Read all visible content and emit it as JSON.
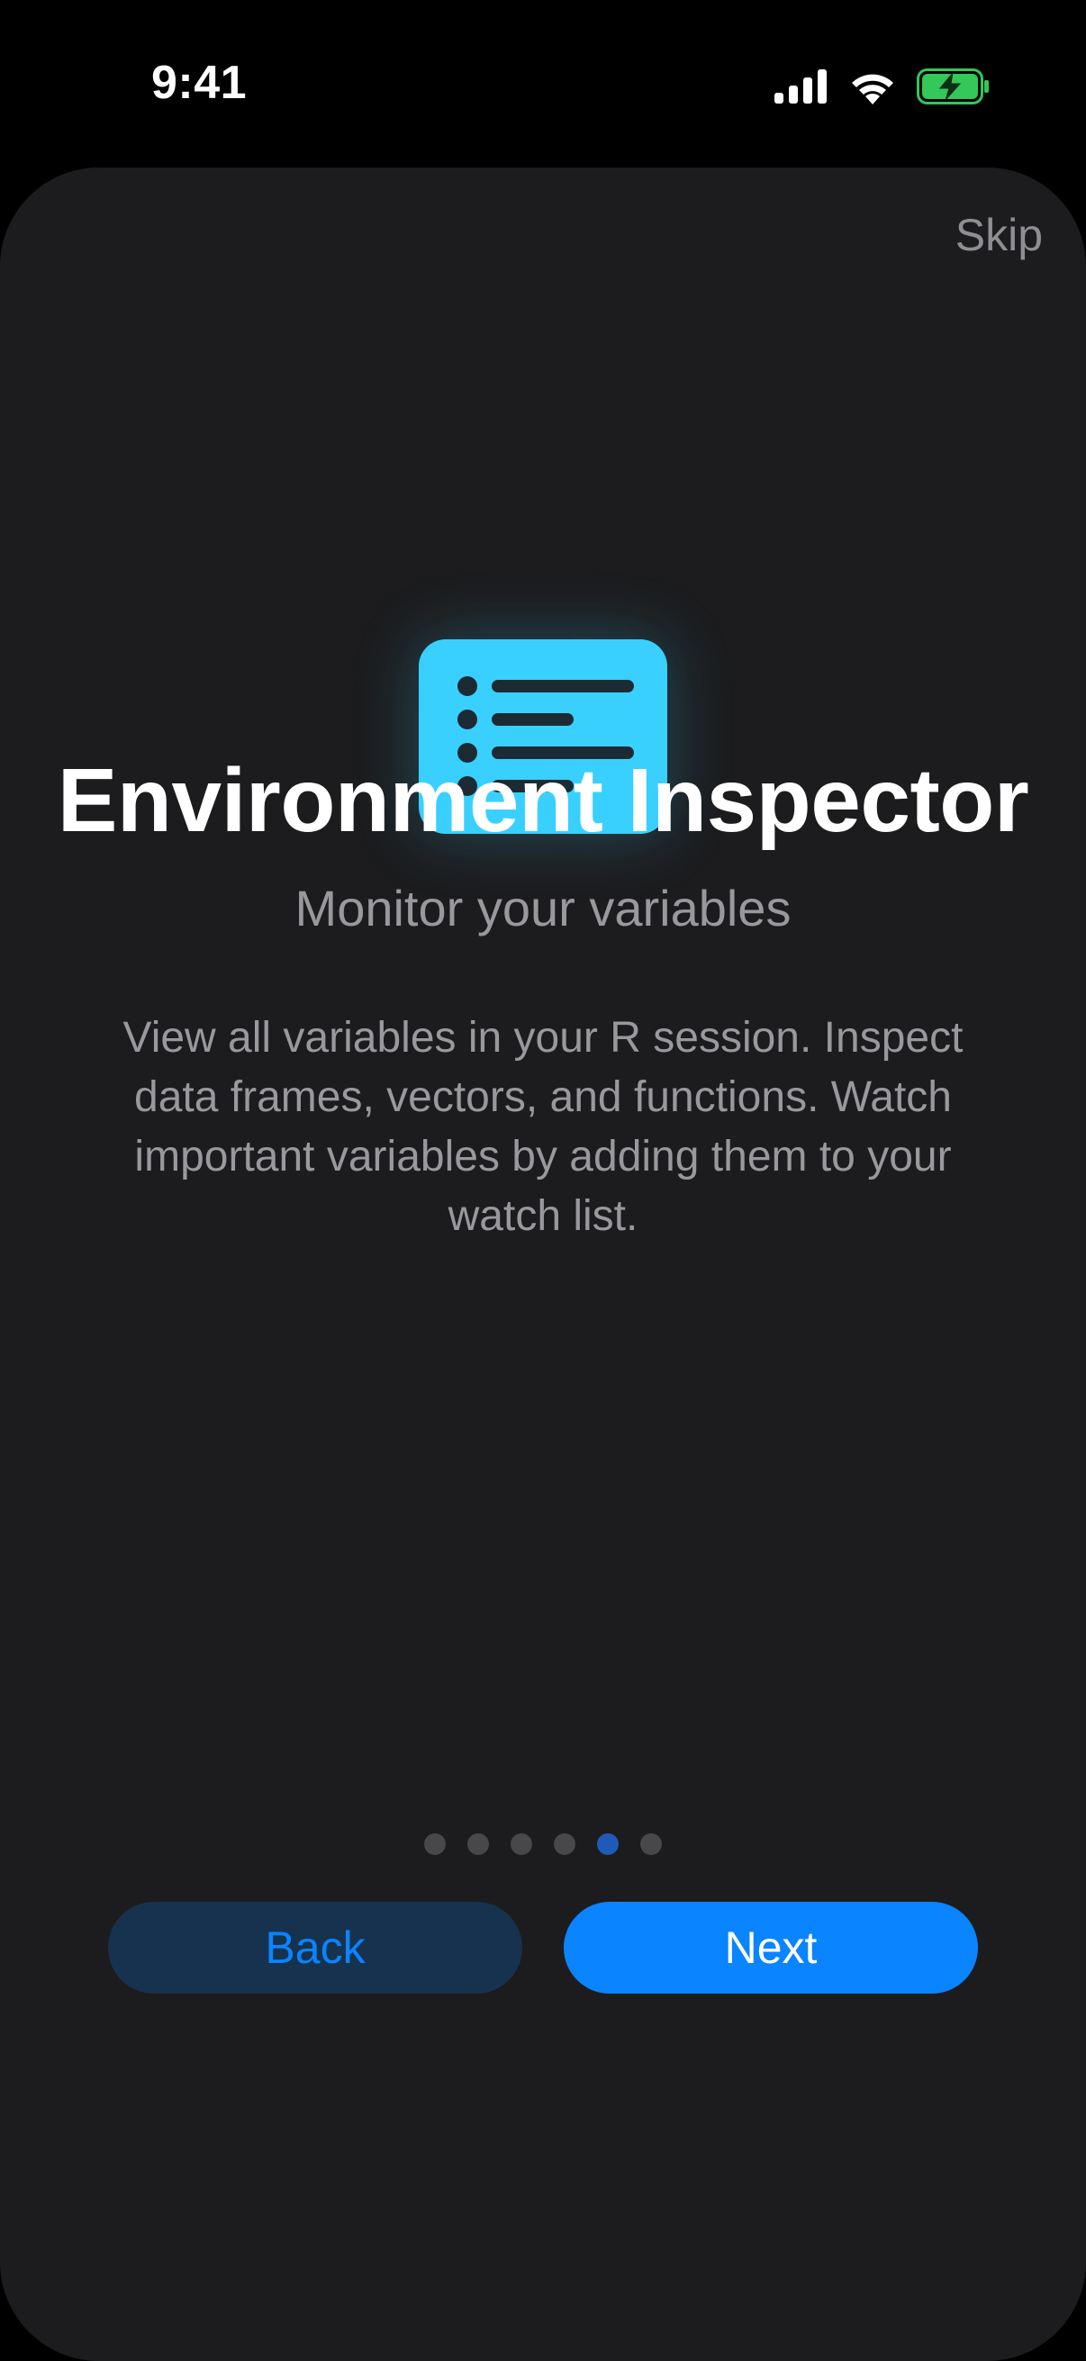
{
  "status_bar": {
    "time": "9:41",
    "icons": [
      "cellular-signal-icon",
      "wifi-icon",
      "battery-charging-icon"
    ],
    "battery_color": "#34c759"
  },
  "onboarding": {
    "skip_label": "Skip",
    "icon": "list-icon",
    "icon_color": "#39d0ff",
    "title": "Environment Inspector",
    "subtitle": "Monitor your variables",
    "description": "View all variables in your R session. Inspect data frames, vectors, and functions. Watch important variables by adding them to your watch list.",
    "page_count": 6,
    "current_page": 5,
    "back_label": "Back",
    "next_label": "Next",
    "accent_color": "#0a84ff"
  }
}
